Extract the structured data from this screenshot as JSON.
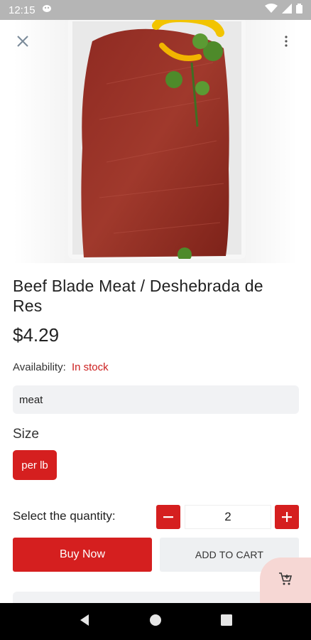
{
  "status_bar": {
    "time": "12:15"
  },
  "product": {
    "title": "Beef Blade Meat / Deshebrada de Res",
    "price": "$4.29",
    "availability_label": "Availability:",
    "availability_status": "In stock",
    "tag": "meat",
    "size_label": "Size",
    "size_option": "per lb"
  },
  "quantity": {
    "label": "Select the quantity:",
    "value": "2",
    "minus": "−",
    "plus": "+"
  },
  "actions": {
    "buy_now": "Buy Now",
    "add_to_cart": "ADD TO CART"
  },
  "icons": {
    "close": "close-icon",
    "more": "more-vert-icon",
    "cart": "add-to-cart-icon",
    "back": "nav-back-icon",
    "home": "nav-home-icon",
    "recents": "nav-recents-icon"
  },
  "colors": {
    "accent": "#d51f1f",
    "in_stock": "#cc1f1f",
    "secondary_button": "#eef0f2",
    "cart_fab": "#f6d7d4"
  }
}
